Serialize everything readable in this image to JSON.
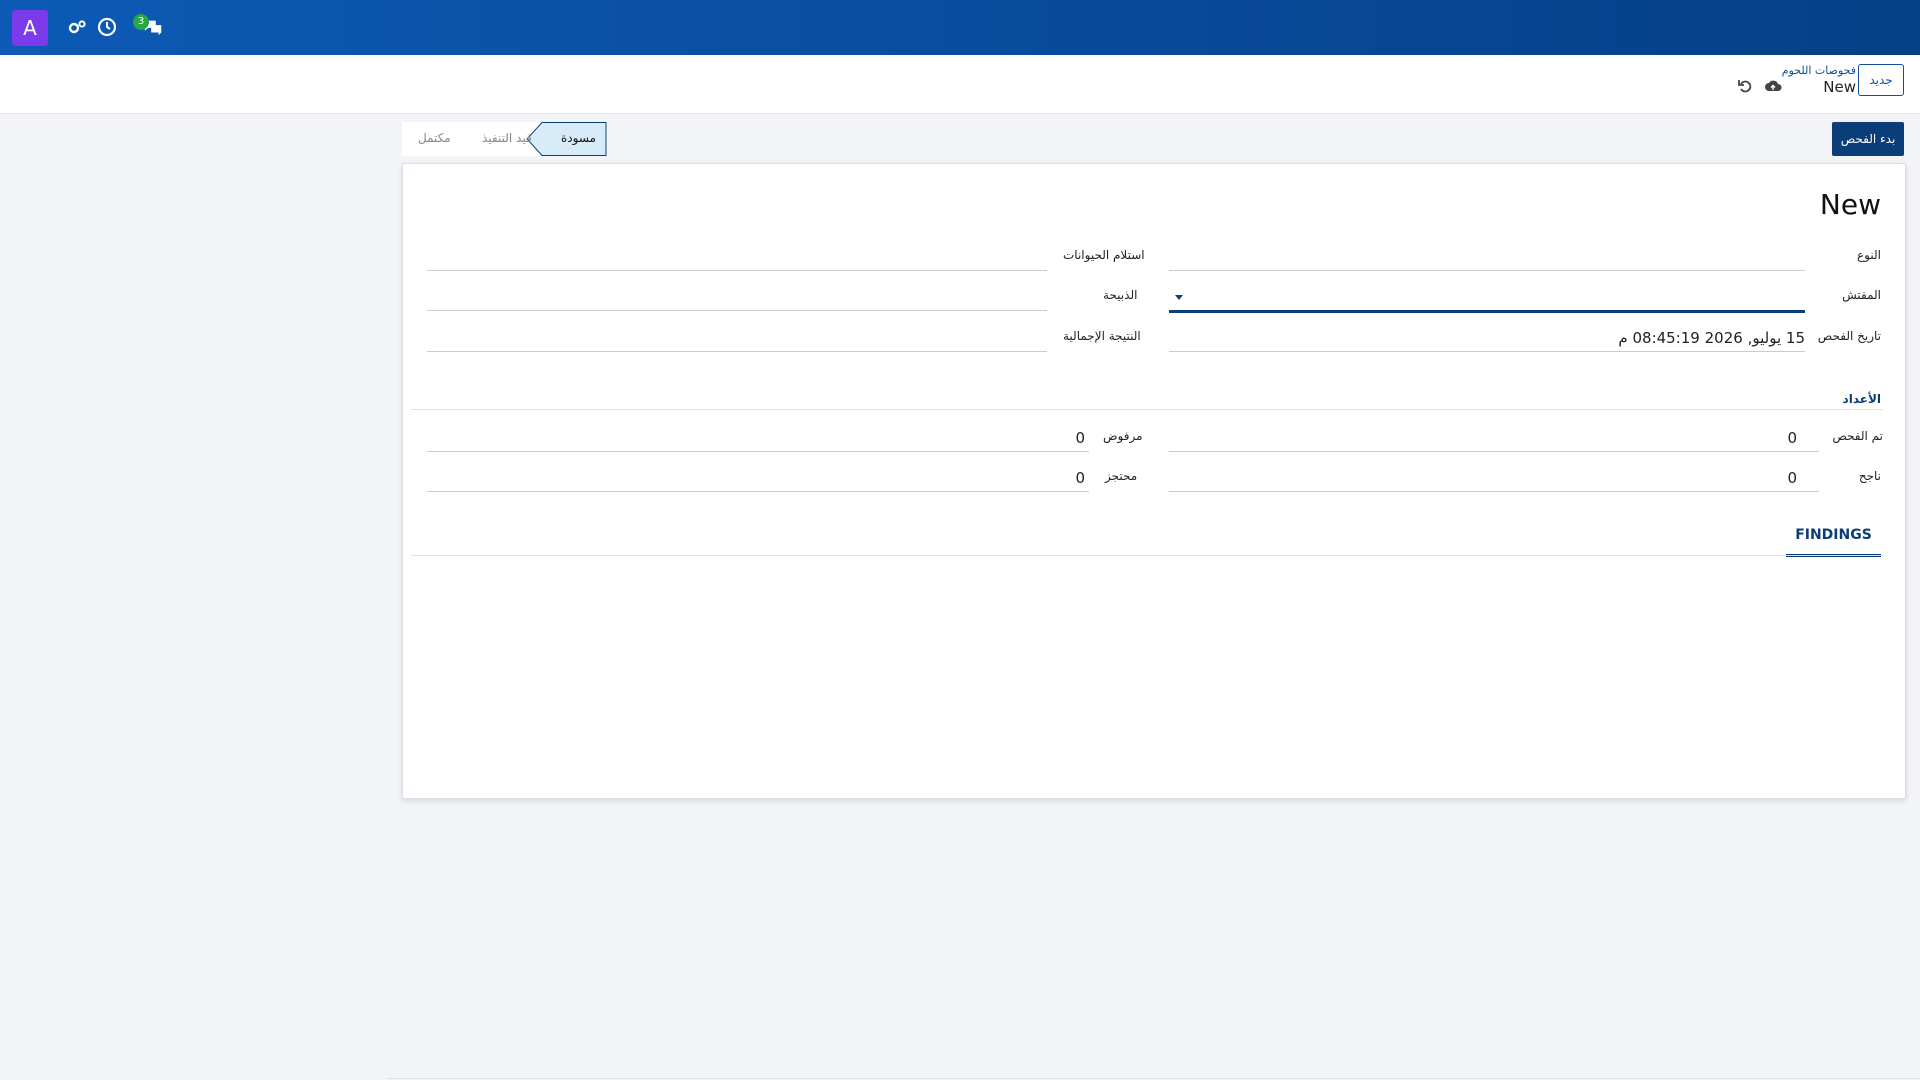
{
  "navbar": {
    "avatar_letter": "A",
    "chat_badge": "3"
  },
  "control": {
    "new_button": "جديد",
    "breadcrumb_parent": "فحوصات اللحوم",
    "breadcrumb_current": "New"
  },
  "status": {
    "start_button": "بدء الفحص",
    "stages": [
      "مسودة",
      "قيد التنفيذ",
      "مكتمل"
    ]
  },
  "form": {
    "title": "New",
    "type_label": "النوع",
    "type_value": "",
    "inspector_label": "المفتش",
    "inspector_value": "",
    "date_label": "تاريخ الفحص",
    "date_value": "15 يوليو, 2026 08:45:19 م",
    "reception_label": "استلام الحيوانات",
    "reception_value": "",
    "slaughter_label": "الذبيحة",
    "slaughter_value": "",
    "result_label": "النتيجة الإجمالية",
    "result_value": "",
    "counts_title": "الأعداد",
    "inspected_label": "تم الفحص",
    "inspected_value": "0",
    "passed_label": "ناجح",
    "passed_value": "0",
    "rejected_label": "مرفوض",
    "rejected_value": "0",
    "held_label": "محتجز",
    "held_value": "0",
    "tab_findings": "FINDINGS"
  },
  "colors": {
    "primary": "#0b3d78",
    "avatar": "#7c3aed",
    "badge": "#28a745",
    "active_stage": "#d7ecf8"
  }
}
